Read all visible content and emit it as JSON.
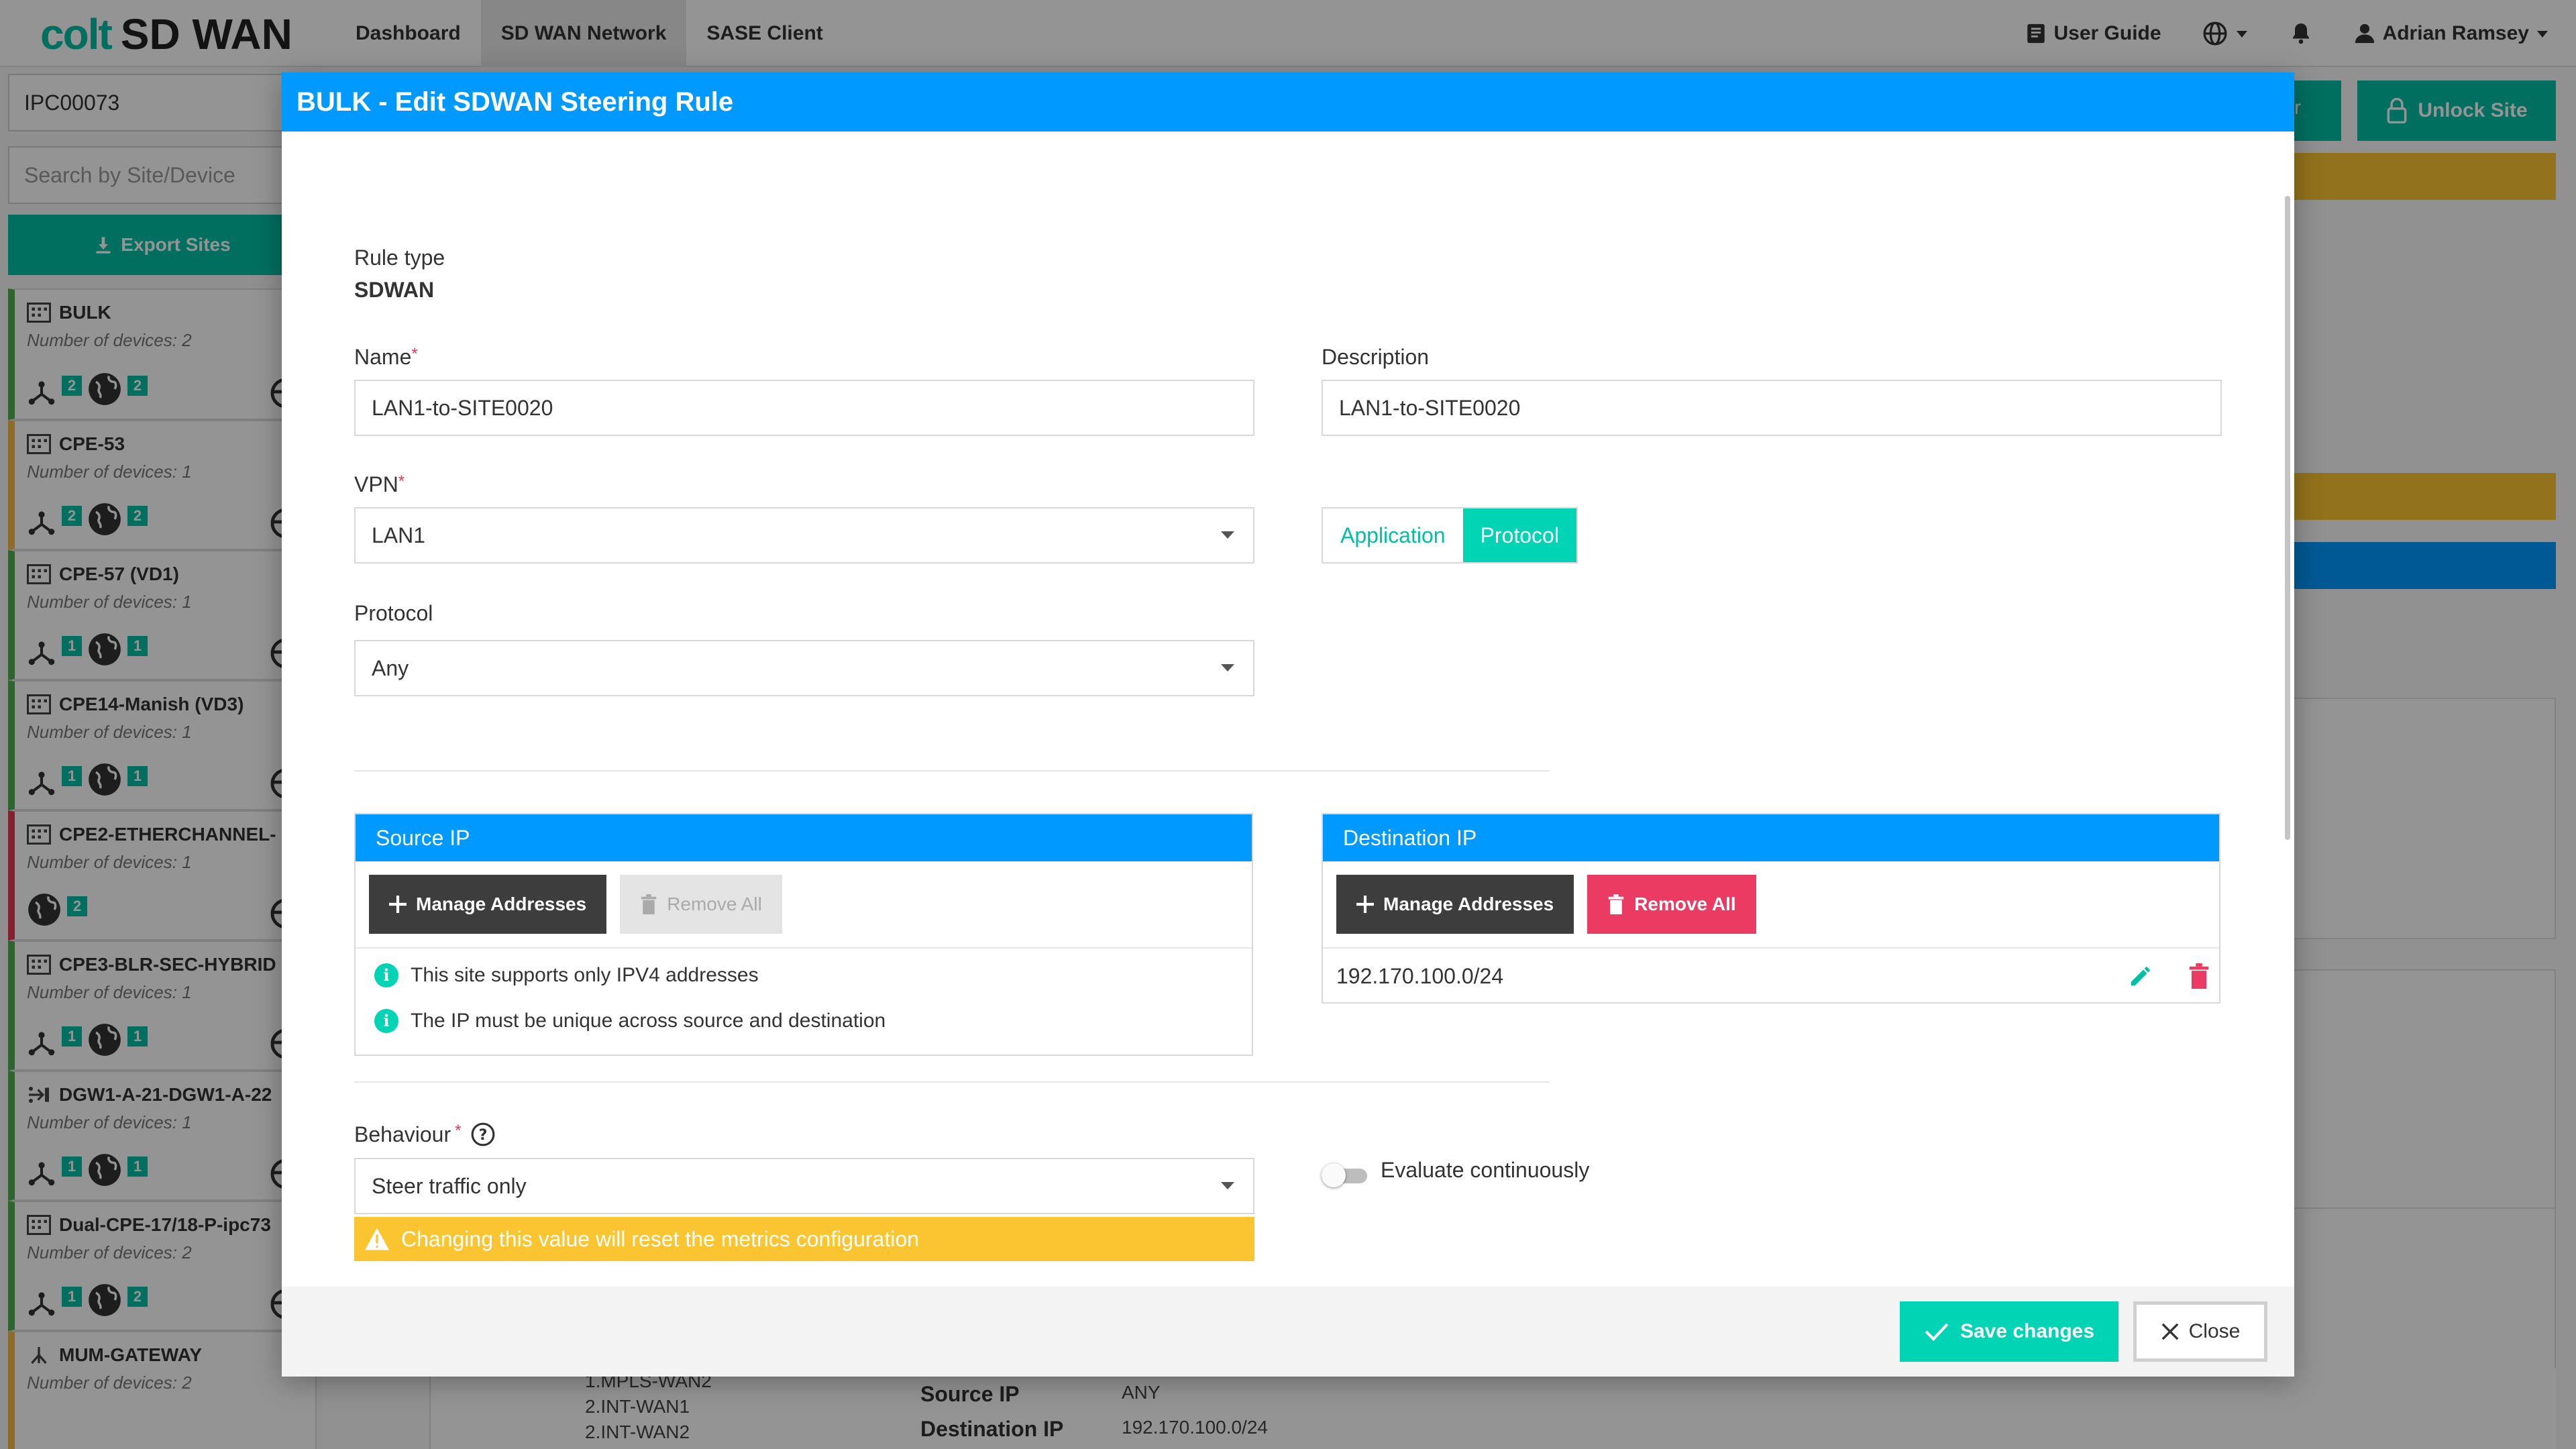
{
  "app": {
    "logo_brand": "colt",
    "logo_product": "SD WAN",
    "nav": [
      {
        "label": "Dashboard"
      },
      {
        "label": "SD WAN Network"
      },
      {
        "label": "SASE Client"
      }
    ],
    "user_guide": "User Guide",
    "user_name": "Adrian Ramsey"
  },
  "sidebar": {
    "site_id": "IPC00073",
    "search_placeholder": "Search by Site/Device",
    "export_label": "Export Sites",
    "sites": [
      {
        "name": "BULK",
        "devices": "Number of devices: 2",
        "badge_a": "2",
        "badge_b": "2"
      },
      {
        "name": "CPE-53",
        "devices": "Number of devices: 1",
        "badge_a": "2",
        "badge_b": "2"
      },
      {
        "name": "CPE-57 (VD1)",
        "devices": "Number of devices: 1",
        "badge_a": "1",
        "badge_b": "1"
      },
      {
        "name": "CPE14-Manish (VD3)",
        "devices": "Number of devices: 1",
        "badge_a": "1",
        "badge_b": "1"
      },
      {
        "name": "CPE2-ETHERCHANNEL-",
        "devices": "Number of devices: 1",
        "badge_b": "2"
      },
      {
        "name": "CPE3-BLR-SEC-HYBRID",
        "devices": "Number of devices: 1",
        "badge_a": "1",
        "badge_b": "1"
      },
      {
        "name": "DGW1-A-21-DGW1-A-22",
        "devices": "Number of devices: 1",
        "badge_a": "1",
        "badge_b": "1"
      },
      {
        "name": "Dual-CPE-17/18-P-ipc73",
        "devices": "Number of devices: 2",
        "badge_a": "1",
        "badge_b": "2"
      },
      {
        "name": "MUM-GATEWAY",
        "devices": "Number of devices: 2"
      }
    ]
  },
  "background": {
    "unlock_label": "Unlock Site",
    "stub_letter": "r",
    "summary": {
      "wan_list": [
        "1.MPLS-WAN2",
        "2.INT-WAN1",
        "2.INT-WAN2"
      ],
      "source_label": "Source IP",
      "source_value": "ANY",
      "dest_label": "Destination IP",
      "dest_value": "192.170.100.0/24"
    }
  },
  "modal": {
    "title": "BULK - Edit SDWAN Steering Rule",
    "rule_type_label": "Rule type",
    "rule_type_value": "SDWAN",
    "name_label": "Name",
    "name_value": "LAN1-to-SITE0020",
    "description_label": "Description",
    "description_value": "LAN1-to-SITE0020",
    "vpn_label": "VPN",
    "vpn_value": "LAN1",
    "match_tabs": [
      {
        "label": "Application"
      },
      {
        "label": "Protocol"
      }
    ],
    "protocol_label": "Protocol",
    "protocol_value": "Any",
    "source_ip": {
      "title": "Source IP",
      "manage_label": "Manage Addresses",
      "remove_label": "Remove All",
      "info": [
        "This site supports only IPV4 addresses",
        "The IP must be unique across source and destination"
      ]
    },
    "destination_ip": {
      "title": "Destination IP",
      "manage_label": "Manage Addresses",
      "remove_label": "Remove All",
      "addresses": [
        "192.170.100.0/24"
      ]
    },
    "behaviour_label": "Behaviour",
    "behaviour_value": "Steer traffic only",
    "behaviour_warning": "Changing this value will reset the metrics configuration",
    "evaluate_label": "Evaluate continuously",
    "save_label": "Save changes",
    "close_label": "Close"
  },
  "colors": {
    "brand": "#00bfa5",
    "header_blue": "#0099ff",
    "accent_teal": "#00d4b4",
    "danger": "#ec3b63",
    "warning": "#fbc531"
  }
}
